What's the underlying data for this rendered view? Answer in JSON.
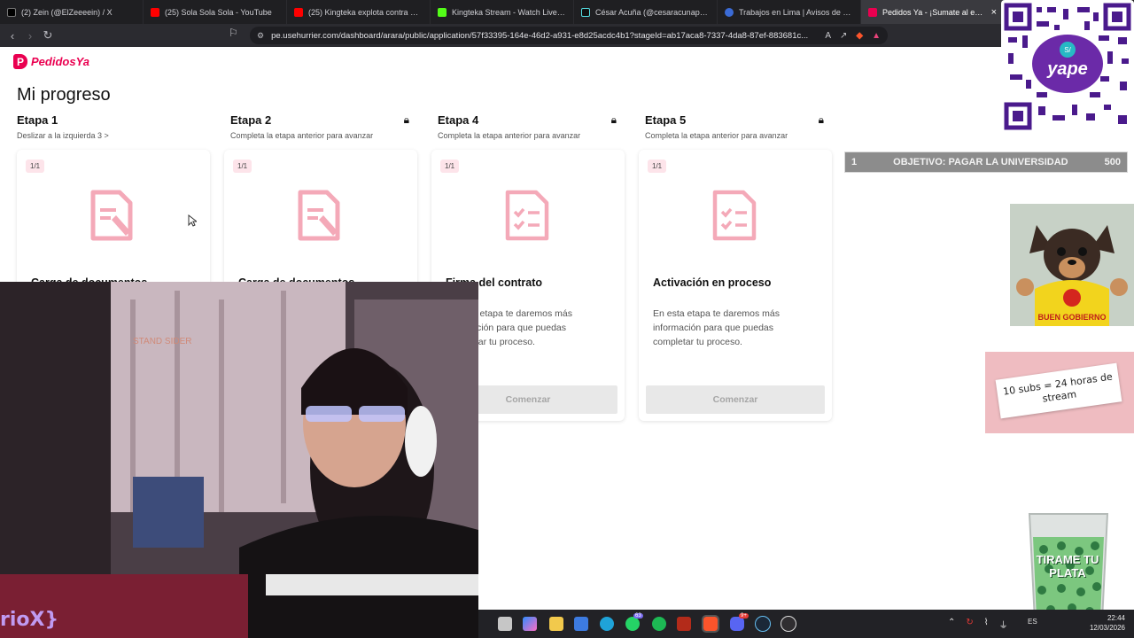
{
  "browser": {
    "tabs": [
      {
        "label": "(2) Zein (@ElZeeeein) / X",
        "color": "#000000",
        "active": false
      },
      {
        "label": "(25) Sola Sola Sola - YouTube",
        "color": "#ff0000",
        "active": false
      },
      {
        "label": "(25) Kingteka explota contra Glogloking",
        "color": "#ff0000",
        "active": false
      },
      {
        "label": "Kingteka Stream - Watch Live on Kick",
        "color": "#53fc18",
        "active": false
      },
      {
        "label": "César Acuña (@cesaracunap) | TikTok",
        "color": "#111111",
        "active": false
      },
      {
        "label": "Trabajos en Lima | Avisos de empleo",
        "color": "#3b6bd6",
        "active": false
      },
      {
        "label": "Pedidos Ya - ¡Sumate al equipo!",
        "color": "#ea0050",
        "active": true
      }
    ],
    "url": "pe.usehurrier.com/dashboard/arara/public/application/57f33395-164e-46d2-a931-e8d25acdc4b1?stageId=ab17aca8-7337-4da8-87ef-883681c..."
  },
  "page": {
    "logo": "PedidosYa",
    "title": "Mi progreso",
    "stages": [
      {
        "name": "Etapa 1",
        "sub": "Deslizar a la izquierda 3 >",
        "locked": false,
        "badge": "1/1",
        "card_title": "Carga de documentos",
        "desc": "",
        "button": ""
      },
      {
        "name": "Etapa 2",
        "sub": "Completa la etapa anterior para avanzar",
        "locked": true,
        "badge": "1/1",
        "card_title": "Carga de documentos",
        "desc": "",
        "button": ""
      },
      {
        "name": "Etapa 4",
        "sub": "Completa la etapa anterior para avanzar",
        "locked": true,
        "badge": "1/1",
        "card_title": "Firma del contrato",
        "desc": "En esta etapa te daremos más información para que puedas completar tu proceso.",
        "button": "Comenzar"
      },
      {
        "name": "Etapa 5",
        "sub": "Completa la etapa anterior para avanzar",
        "locked": true,
        "badge": "1/1",
        "card_title": "Activación en proceso",
        "desc": "En esta etapa te daremos más información para que puedas completar tu proceso.",
        "button": "Comenzar"
      }
    ],
    "accent_color": "#ea0050",
    "icon_color": "#f4a9b8"
  },
  "overlay": {
    "qr_label": "yape",
    "goal": {
      "left": "1",
      "text": "OBJETIVO: PAGAR LA UNIVERSIDAD",
      "right": "500"
    },
    "dog_shirt": "BUEN GOBIERNO",
    "subs_note": "10 subs = 24 horas de stream",
    "cup_text": "TIRAME TU PLATA",
    "cam_handle": "rioX}",
    "cam_sign": "STAND SIDER"
  },
  "taskbar": {
    "badges": {
      "whatsapp": "63",
      "discord": "9+"
    },
    "lang": "ES",
    "time": "22:44",
    "date": "12/03/2026"
  }
}
